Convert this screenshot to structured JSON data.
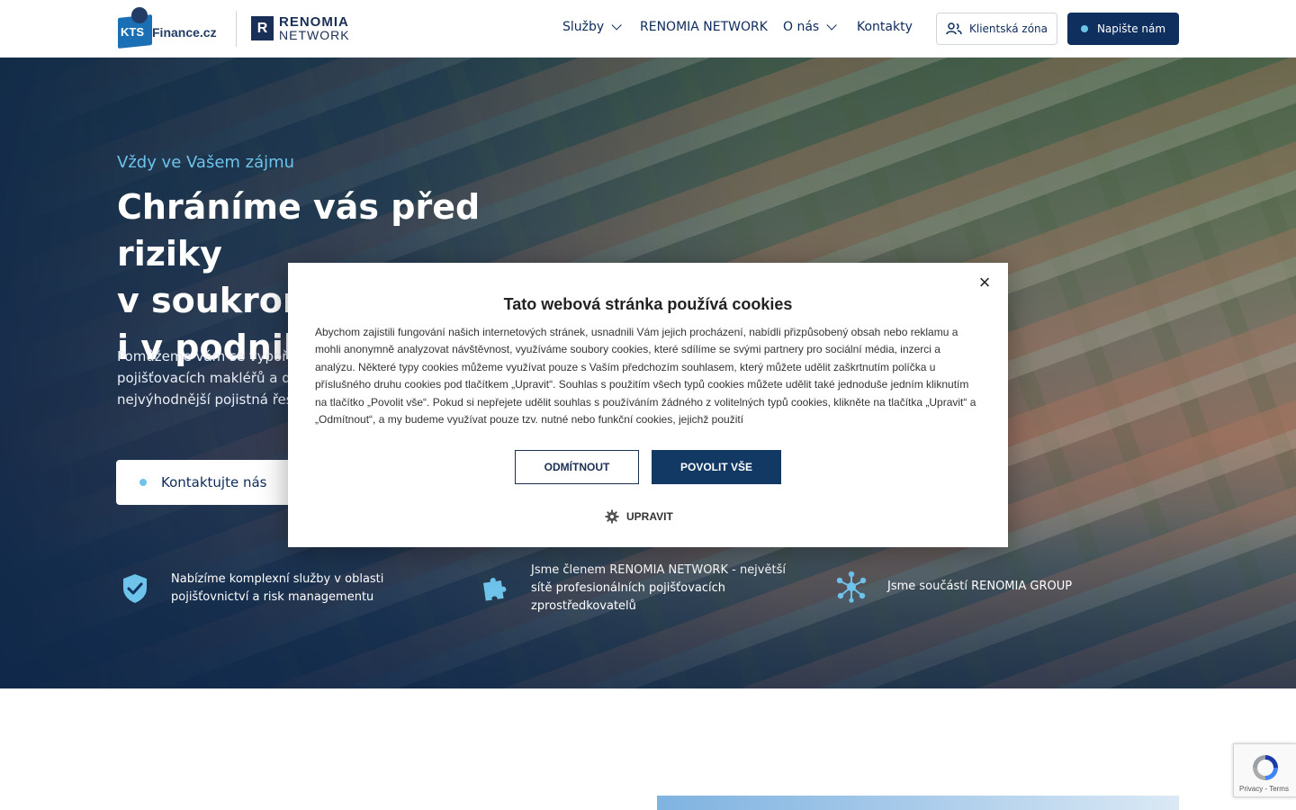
{
  "header": {
    "logo_kts": "KTS",
    "logo_finance": "Finance.cz",
    "logo_renomia_top": "RENOMIA",
    "logo_renomia_bottom": "NETWORK",
    "nav": {
      "services": "Služby",
      "network": "RENOMIA NETWORK",
      "about": "O nás",
      "contact": "Kontakty"
    },
    "client_zone": "Klientská zóna",
    "write_us": "Napište nám"
  },
  "hero": {
    "kicker": "Vždy ve Vašem zájmu",
    "title_line1": "Chráníme vás před riziky",
    "title_line2": "v soukromém životě",
    "title_line3": "i v podnikání",
    "text": "Pomůžeme vám se vypořádat s riziky. Jsme součástí největší české sítě pojišťovacích makléřů a díky tomu jsme schopni nabídnout ta nejvýhodnější pojistná řešení.",
    "cta": "Kontaktujte nás"
  },
  "features": [
    {
      "icon": "shield-check-icon",
      "text": "Nabízíme komplexní služby v oblasti pojišťovnictví a risk managementu"
    },
    {
      "icon": "puzzle-icon",
      "text": "Jsme členem RENOMIA NETWORK - největší sítě profesionálních pojišťovacích zprostředkovatelů"
    },
    {
      "icon": "network-icon",
      "text": "Jsme součástí RENOMIA GROUP"
    }
  ],
  "cookie": {
    "title": "Tato webová stránka používá cookies",
    "body": "Abychom zajistili fungování našich internetových stránek, usnadnili Vám jejich procházení, nabídli přizpůsobený obsah nebo reklamu a mohli anonymně analyzovat návštěvnost, využíváme soubory cookies, které sdílíme se svými partnery pro sociální média, inzerci a analýzu. Některé typy cookies můžeme využívat pouze s Vaším předchozím souhlasem, který můžete udělit zaškrtnutím políčka u příslušného druhu cookies pod tlačítkem „Upravit“. Souhlas s použitím všech typů cookies můžete udělit také jednoduše jedním kliknutím na tlačítko „Povolit vše“. Pokud si nepřejete udělit souhlas s používáním žádného z volitelných typů cookies, klikněte na tlačítka „Upravit“ a „Odmítnout“, a my budeme využívat pouze tzv. nutné nebo funkční cookies, jejichž použití",
    "decline": "ODMÍTNOUT",
    "accept": "POVOLIT VŠE",
    "edit": "UPRAVIT",
    "close": "×"
  },
  "recaptcha": {
    "links": "Privacy - Terms"
  },
  "colors": {
    "navy": "#0f2f5e",
    "accent": "#6ec3ea",
    "cookie_accept": "#123864"
  }
}
